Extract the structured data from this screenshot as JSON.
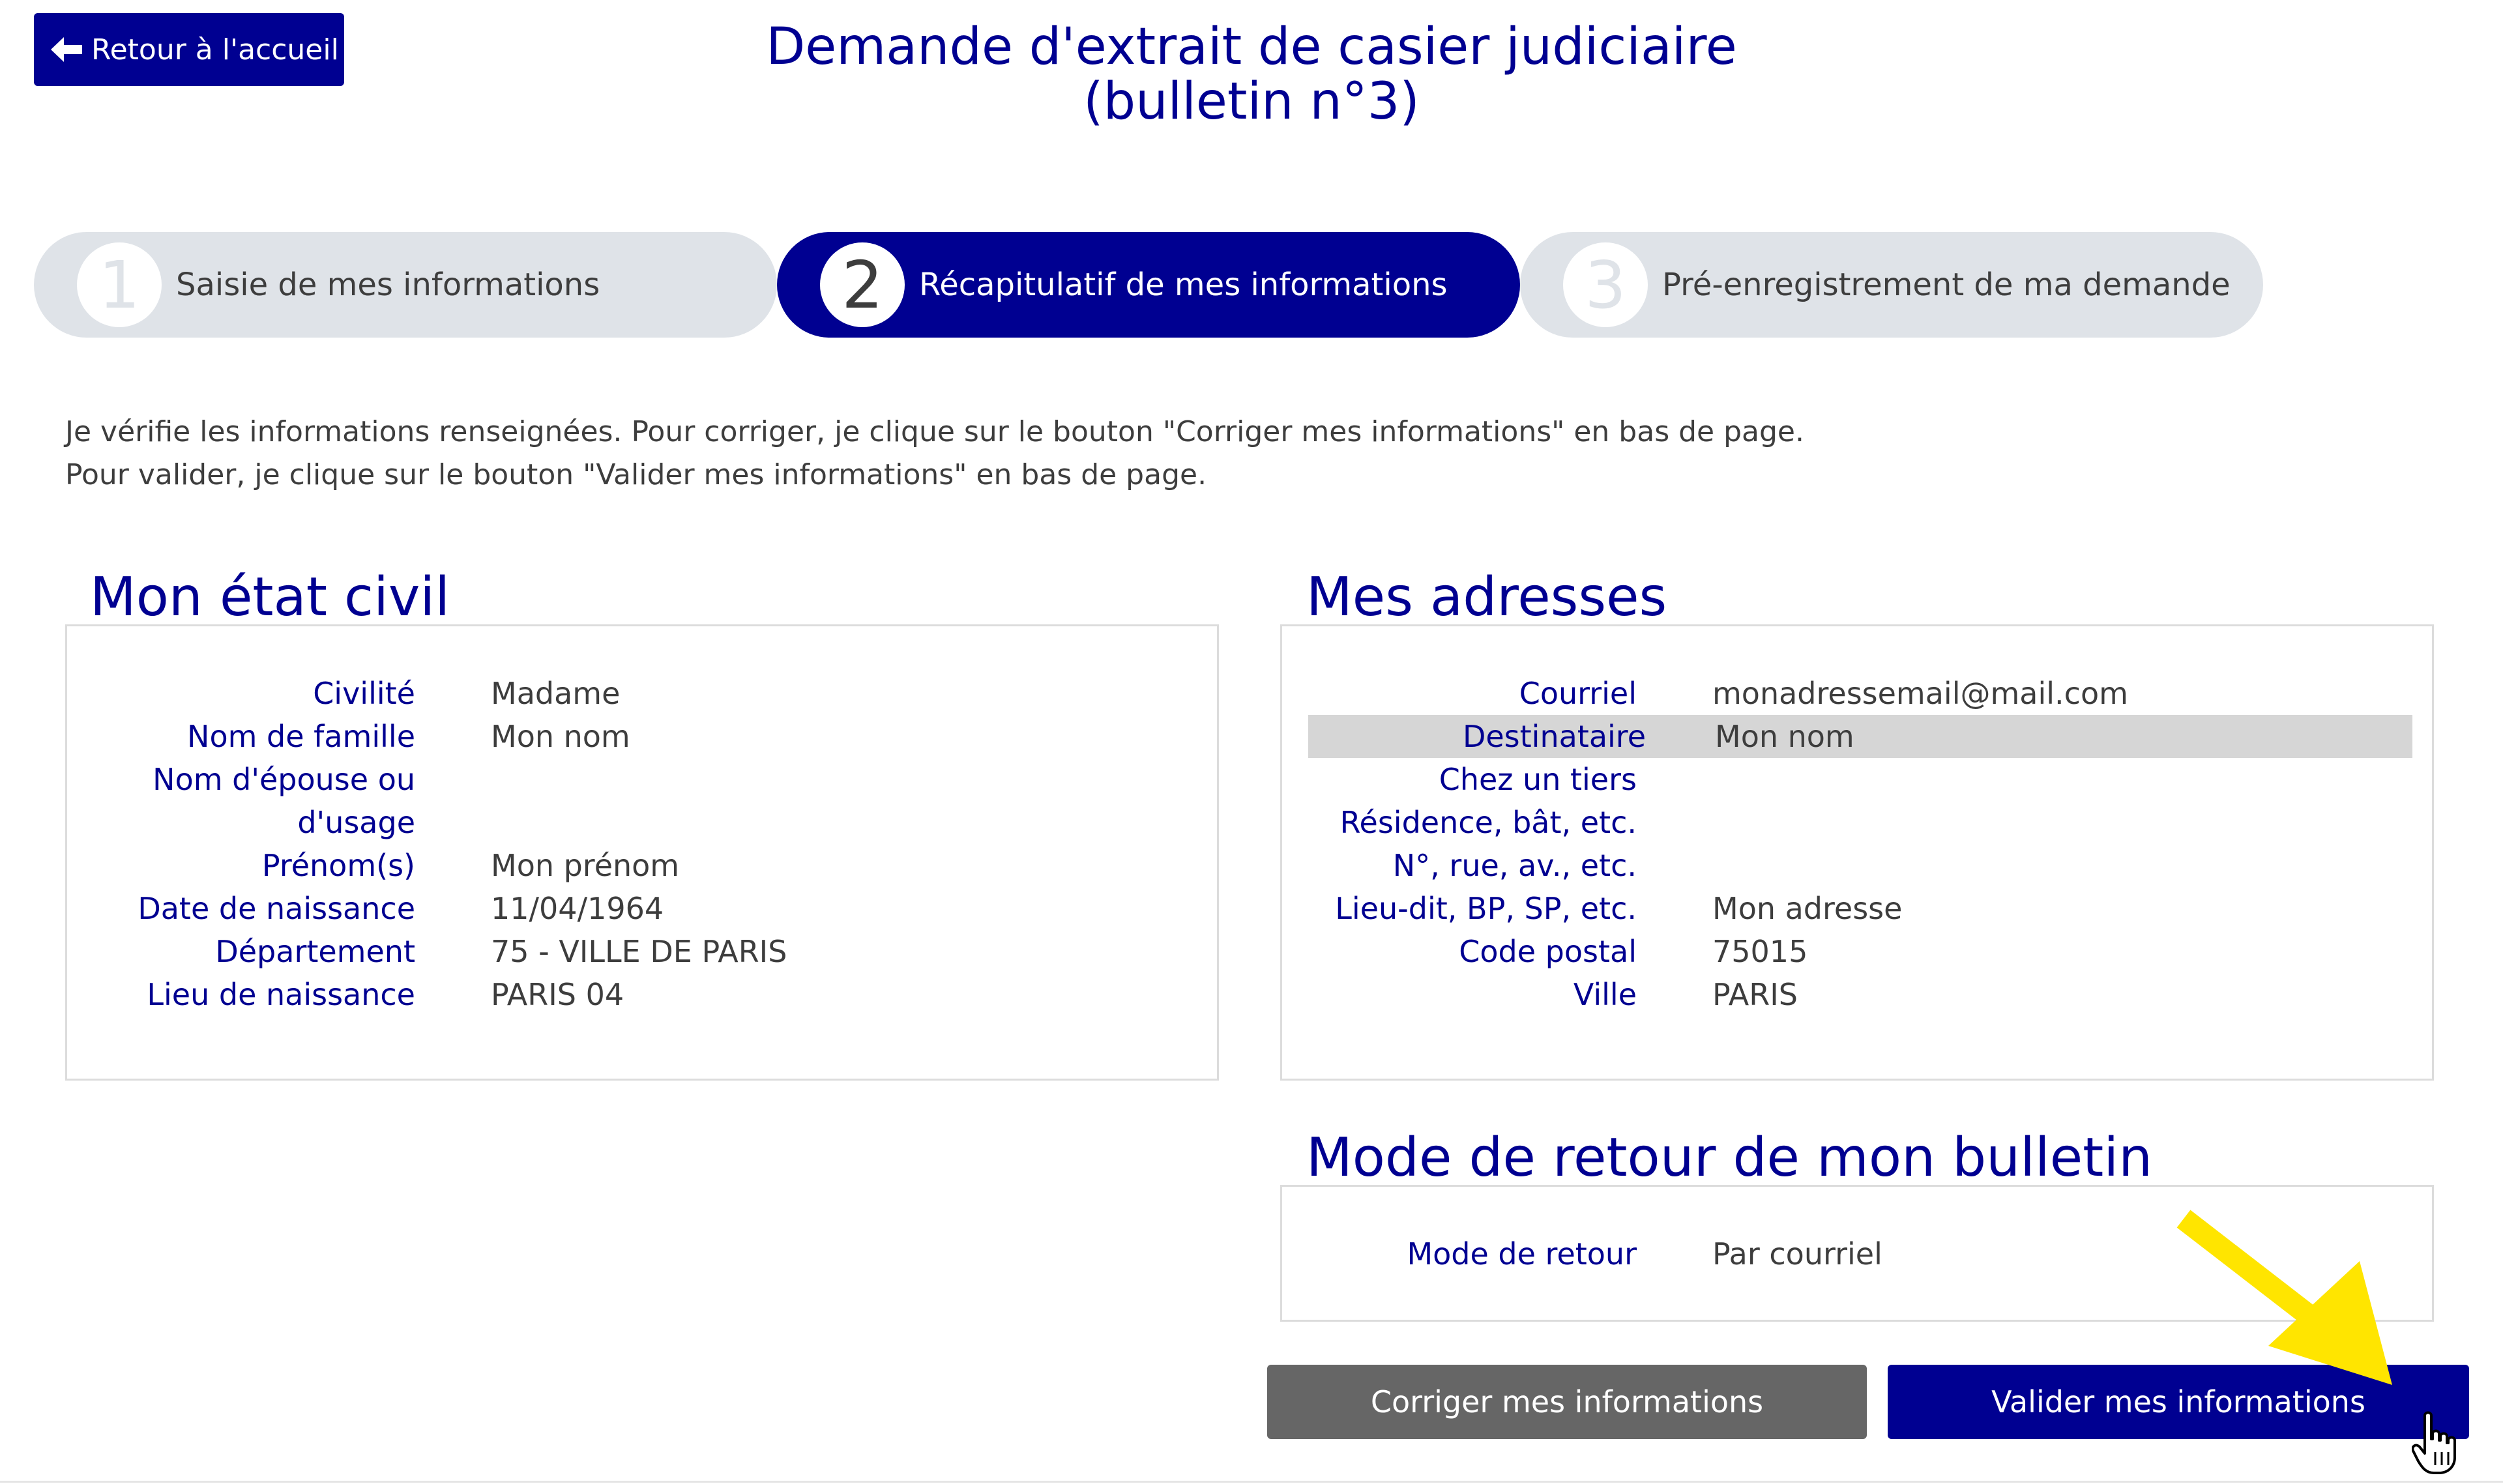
{
  "back_button": {
    "label": "Retour à l'accueil"
  },
  "title": {
    "line1": "Demande d'extrait de casier judiciaire",
    "line2": "(bulletin n°3)"
  },
  "steps": [
    {
      "number": "1",
      "label": "Saisie de mes informations"
    },
    {
      "number": "2",
      "label": "Récapitulatif de mes informations"
    },
    {
      "number": "3",
      "label": "Pré-enregistrement de ma demande"
    }
  ],
  "intro": {
    "line1": "Je vérifie les informations renseignées. Pour corriger, je clique sur le bouton \"Corriger mes informations\" en bas de page.",
    "line2": "Pour valider, je clique sur le bouton \"Valider mes informations\" en bas de page."
  },
  "etat_civil": {
    "title": "Mon état civil",
    "rows": [
      {
        "label": "Civilité",
        "value": "Madame"
      },
      {
        "label": "Nom de famille",
        "value": "Mon nom"
      },
      {
        "label": "Nom d'épouse ou",
        "value": ""
      },
      {
        "label": "d'usage",
        "value": ""
      },
      {
        "label": "Prénom(s)",
        "value": "Mon prénom"
      },
      {
        "label": "Date de naissance",
        "value": "11/04/1964"
      },
      {
        "label": "Département",
        "value": "75 - VILLE DE PARIS"
      },
      {
        "label": "Lieu de naissance",
        "value": "PARIS 04"
      }
    ]
  },
  "adresses": {
    "title": "Mes adresses",
    "rows": [
      {
        "label": "Courriel",
        "value": "monadressemail@mail.com"
      },
      {
        "label": "Destinataire",
        "value": "Mon nom"
      },
      {
        "label": "Chez un tiers",
        "value": ""
      },
      {
        "label": "Résidence, bât, etc.",
        "value": ""
      },
      {
        "label": "N°, rue, av., etc.",
        "value": ""
      },
      {
        "label": "Lieu-dit, BP, SP, etc.",
        "value": "Mon adresse"
      },
      {
        "label": "Code postal",
        "value": "75015"
      },
      {
        "label": "Ville",
        "value": "PARIS"
      }
    ]
  },
  "mode_retour": {
    "title": "Mode de retour de mon bulletin",
    "label": "Mode de retour",
    "value": "Par courriel"
  },
  "buttons": {
    "correct": "Corriger mes informations",
    "validate": "Valider mes informations"
  },
  "colors": {
    "brand_blue": "#000091",
    "highlight_arrow": "#ffe500",
    "secondary_button": "#666666"
  }
}
